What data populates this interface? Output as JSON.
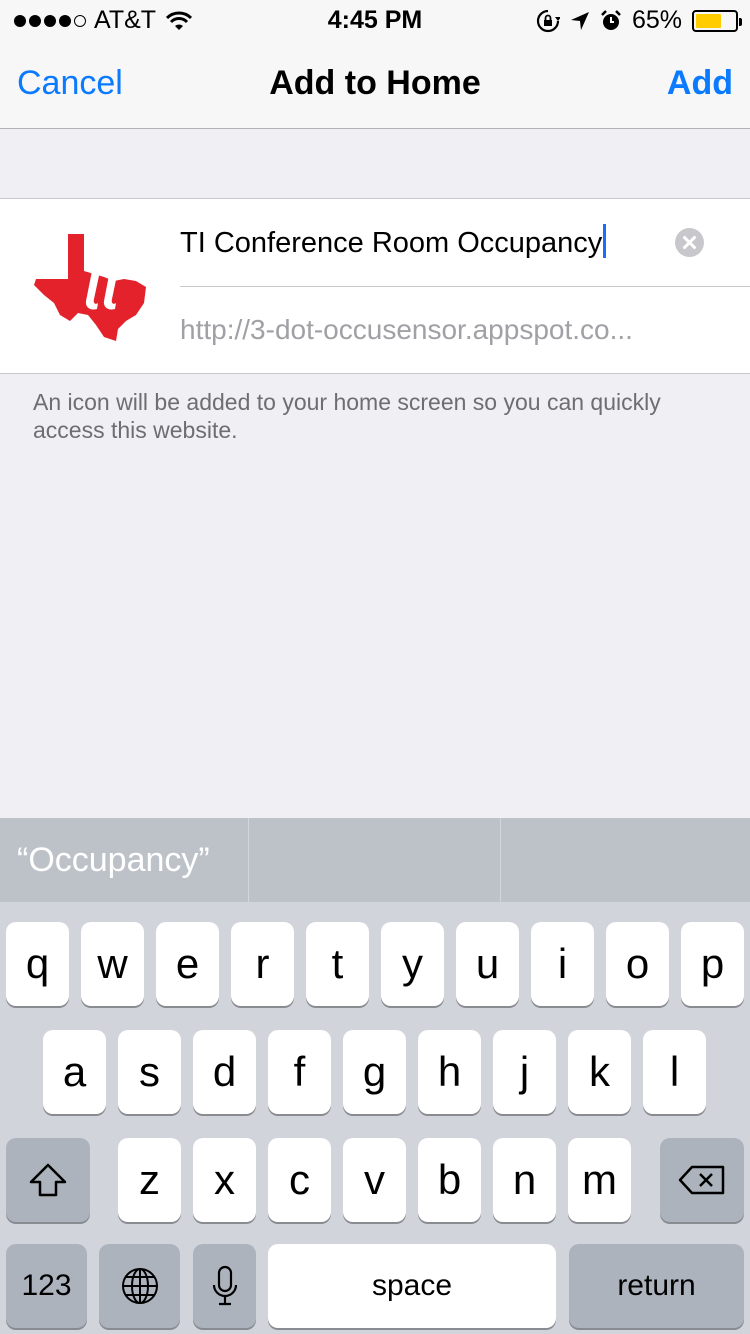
{
  "status_bar": {
    "carrier": "AT&T",
    "time": "4:45 PM",
    "battery_percent": "65%",
    "battery_level": 0.65,
    "battery_color": "#ffcc00",
    "icons": [
      "signal-dots-icon",
      "wifi-icon",
      "rotation-lock-icon",
      "location-arrow-icon",
      "alarm-icon",
      "battery-icon"
    ]
  },
  "nav": {
    "cancel_label": "Cancel",
    "title": "Add to Home",
    "add_label": "Add",
    "accent_color": "#0a7aff"
  },
  "bookmark": {
    "logo_icon": "ti-texas-logo-icon",
    "logo_color": "#e3222b",
    "title_value": "TI Conference Room Occupancy",
    "url": "http://3-dot-occusensor.appspot.co..."
  },
  "hint": "An icon will be added to your home screen so you can quickly access this website.",
  "predictive": {
    "suggestions": [
      "“Occupancy”",
      "",
      ""
    ]
  },
  "keyboard": {
    "row1": [
      "q",
      "w",
      "e",
      "r",
      "t",
      "y",
      "u",
      "i",
      "o",
      "p"
    ],
    "row2": [
      "a",
      "s",
      "d",
      "f",
      "g",
      "h",
      "j",
      "k",
      "l"
    ],
    "row3": [
      "z",
      "x",
      "c",
      "v",
      "b",
      "n",
      "m"
    ],
    "shift_icon": "shift-arrow-icon",
    "delete_icon": "backspace-icon",
    "numbers_label": "123",
    "globe_icon": "globe-icon",
    "mic_icon": "microphone-icon",
    "space_label": "space",
    "return_label": "return"
  }
}
